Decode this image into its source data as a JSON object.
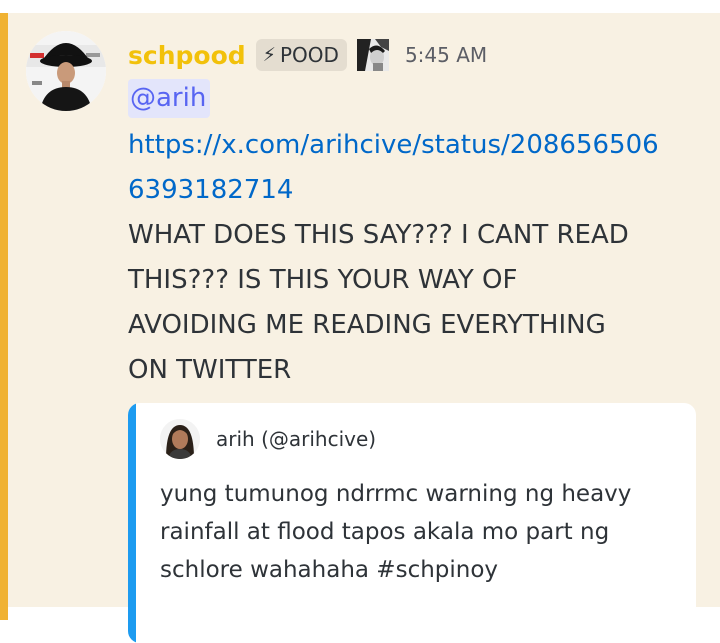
{
  "colors": {
    "mention_highlight": "#f8f1e3",
    "mention_bar": "#f0b232",
    "username": "#f2c10a",
    "link": "#0068c9",
    "mention_text": "#5865f2",
    "mention_bg": "#e3e5fb",
    "embed_bar": "#1d9bf0"
  },
  "message": {
    "author": "schpood",
    "tag": {
      "icon": "⚡",
      "label": "POOD"
    },
    "role_icon": "portrait-role-icon",
    "timestamp": "5:45 AM",
    "mention": "@arih",
    "link_lines": [
      "https://x.com/arihcive/status/208656506",
      "6393182714"
    ],
    "content_lines": [
      "WHAT DOES THIS SAY??? I CANT READ",
      "THIS??? IS THIS YOUR WAY OF",
      "AVOIDING ME READING EVERYTHING",
      "ON TWITTER"
    ]
  },
  "embed": {
    "author": "arih (@arihcive)",
    "description_lines": [
      "yung tumunog ndrrmc warning ng heavy",
      "rainfall at flood tapos akala mo part ng",
      "schlore wahahaha #schpinoy"
    ]
  }
}
